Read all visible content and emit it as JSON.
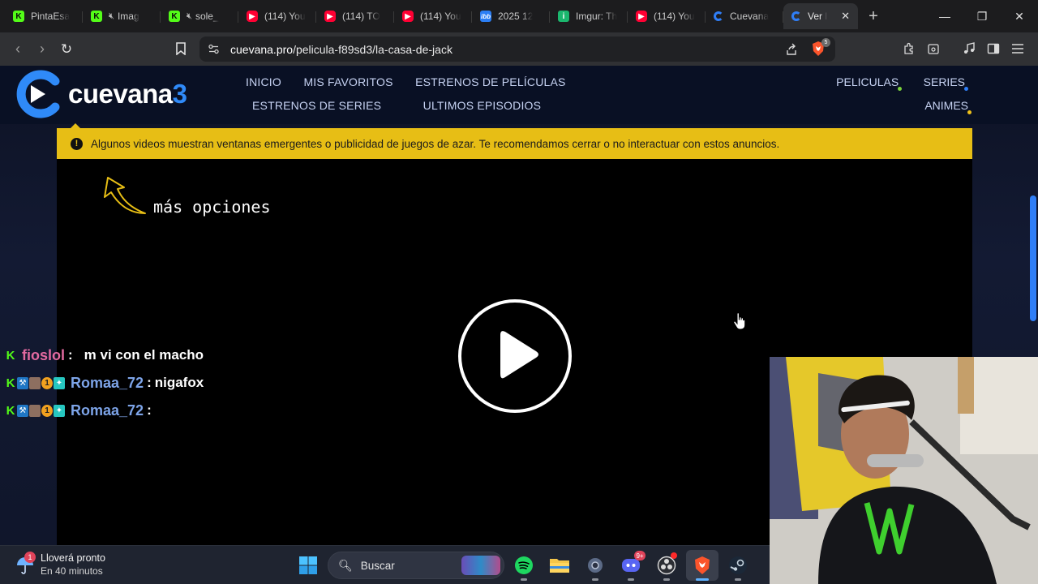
{
  "browser": {
    "tabs": [
      {
        "title": "PintaEsa",
        "icon": "kick-icon",
        "active": false,
        "muted": false
      },
      {
        "title": "Imag",
        "icon": "kick-icon",
        "active": false,
        "muted": true
      },
      {
        "title": "sole_",
        "icon": "kick-icon",
        "active": false,
        "muted": true
      },
      {
        "title": "(114) You",
        "icon": "youtube-icon",
        "active": false,
        "muted": false
      },
      {
        "title": "(114) TO",
        "icon": "youtube-icon",
        "active": false,
        "muted": false
      },
      {
        "title": "(114) You",
        "icon": "youtube-icon",
        "active": false,
        "muted": false
      },
      {
        "title": "2025 12",
        "icon": "imgbb-icon",
        "active": false,
        "muted": false
      },
      {
        "title": "Imgur: Th",
        "icon": "imgur-icon",
        "active": false,
        "muted": false
      },
      {
        "title": "(114) You",
        "icon": "youtube-icon",
        "active": false,
        "muted": false
      },
      {
        "title": "Cuevana",
        "icon": "cuevana-icon",
        "active": false,
        "muted": false
      },
      {
        "title": "Ver l",
        "icon": "cuevana-icon",
        "active": true,
        "muted": false
      }
    ],
    "fav_text": {
      "kick": "K",
      "youtube": "▶",
      "imgbb": "ibb",
      "imgur": "i"
    },
    "address": {
      "host": "cuevana.pro",
      "path": "/pelicula-f89sd3/la-casa-de-jack"
    },
    "shield_count": "5"
  },
  "site": {
    "logo_text": "cuevana",
    "logo_number": "3",
    "nav_left": [
      "INICIO",
      "MIS FAVORITOS",
      "ESTRENOS DE PELÍCULAS",
      "ESTRENOS DE SERIES",
      "ULTIMOS EPISODIOS"
    ],
    "nav_right": [
      "PELICULAS",
      "SERIES",
      "ANIMES"
    ],
    "warning": "Algunos videos muestran ventanas emergentes o publicidad de juegos de azar. Te recomendamos cerrar o no interactuar con estos anuncios.",
    "more_options": "más opciones"
  },
  "chat": [
    {
      "user": "fioslol",
      "message": "m vi con el macho",
      "color": "#e36aa0",
      "badges": [
        "kick"
      ]
    },
    {
      "user": "Romaa_72",
      "message": "nigafox",
      "color": "#7da4e8",
      "badges": [
        "kick",
        "pickaxe",
        "image",
        "gold",
        "gift"
      ]
    },
    {
      "user": "Romaa_72",
      "message": "",
      "color": "#7da4e8",
      "badges": [
        "kick",
        "pickaxe",
        "image",
        "gold",
        "gift"
      ]
    }
  ],
  "taskbar": {
    "weather_title": "Lloverá pronto",
    "weather_sub": "En 40 minutos",
    "weather_badge": "1",
    "search_placeholder": "Buscar",
    "discord_badge": "9+"
  },
  "colors": {
    "accent": "#2f7ef7",
    "warning": "#e7be15",
    "kick": "#53fc18"
  }
}
